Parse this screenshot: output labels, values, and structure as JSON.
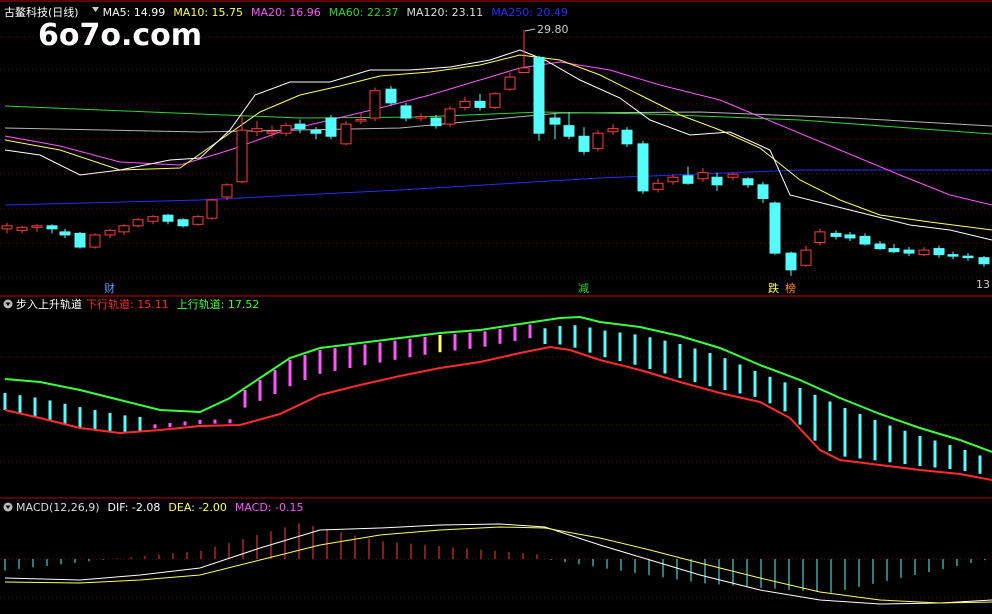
{
  "watermark": "6o7o.com",
  "colors": {
    "bg": "#000000",
    "up": "#ff3b3b",
    "down": "#54fcfc",
    "border": "#b40000",
    "grid": "#3a0a0a",
    "ma5": "#ffffff",
    "ma10": "#ffff54",
    "ma20": "#ff54ff",
    "ma60": "#2ad62a",
    "ma120": "#9a9a9a",
    "ma250": "#2a2aff",
    "upper_band": "#3cff3c",
    "lower_band": "#ff2a2a",
    "dif": "#ffffff",
    "dea": "#ffff54",
    "macd": "#ff54ff"
  },
  "main_panel": {
    "title": "古鳌科技(日线)",
    "legend": [
      {
        "label": "MA5: 14.99",
        "color": "#ffffff"
      },
      {
        "label": "MA10: 15.75",
        "color": "#ffff54"
      },
      {
        "label": "MA20: 16.96",
        "color": "#ff54ff"
      },
      {
        "label": "MA60: 22.37",
        "color": "#2ad62a"
      },
      {
        "label": "MA120: 23.11",
        "color": "#dddddd"
      },
      {
        "label": "MA250: 20.49",
        "color": "#2a2aff"
      }
    ],
    "peak_label": "29.80",
    "right_tick": "13",
    "badges": [
      {
        "text": "财",
        "color": "#54a0ff"
      },
      {
        "text": "减",
        "color": "#2ad62a"
      },
      {
        "text": "跌",
        "color": "#ffff54"
      },
      {
        "text": "榜",
        "color": "#ff8c1a"
      }
    ]
  },
  "track_panel": {
    "title": "步入上升轨道",
    "legend": [
      {
        "label": "下行轨道: 15.11",
        "color": "#ff2a2a"
      },
      {
        "label": "上行轨道: 17.52",
        "color": "#3cff3c"
      }
    ]
  },
  "macd_panel": {
    "legend": [
      {
        "label": "MACD(12,26,9)",
        "color": "#dddddd"
      },
      {
        "label": "DIF: -2.08",
        "color": "#ffffff"
      },
      {
        "label": "DEA: -2.00",
        "color": "#ffff54"
      },
      {
        "label": "MACD: -0.15",
        "color": "#ff54ff"
      }
    ]
  }
}
